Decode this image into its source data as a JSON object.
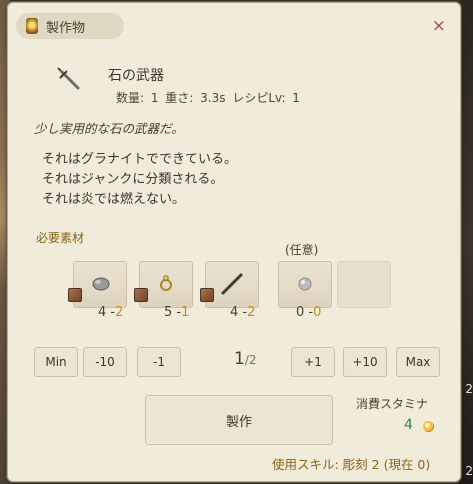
{
  "window": {
    "title": "製作物",
    "close_label": "×"
  },
  "item": {
    "name": "石の武器",
    "meta": "数量: 1  重さ: 3.3s  レシピLv: 1",
    "description": "少し実用的な石の武器だ。",
    "lines": [
      "それはグラナイトでできている。",
      "それはジャンクに分類される。",
      "それは炎では燃えない。"
    ]
  },
  "materials": {
    "label": "必要素材",
    "optional_label": "(任意)",
    "slots": [
      {
        "icon": "stone-icon",
        "need": "4",
        "have": "2"
      },
      {
        "icon": "ring-icon",
        "need": "5",
        "have": "1"
      },
      {
        "icon": "stick-icon",
        "need": "4",
        "have": "2"
      },
      {
        "icon": "gem-icon",
        "need": "0",
        "have": "0"
      }
    ]
  },
  "controls": {
    "min": "Min",
    "minus10": "-10",
    "minus1": "-1",
    "page_current": "1",
    "page_total": "/2",
    "plus1": "+1",
    "plus10": "+10",
    "max": "Max"
  },
  "craft": {
    "label": "製作"
  },
  "stamina": {
    "label": "消費スタミナ",
    "value": "4"
  },
  "skill": {
    "text": "使用スキル: 彫刻 2 (現在 0)"
  },
  "colors": {
    "accent": "#cc8d16",
    "panel_bg": "#f1ebdb",
    "stamina_green": "#2e8a48",
    "close_red": "#a44d46"
  }
}
